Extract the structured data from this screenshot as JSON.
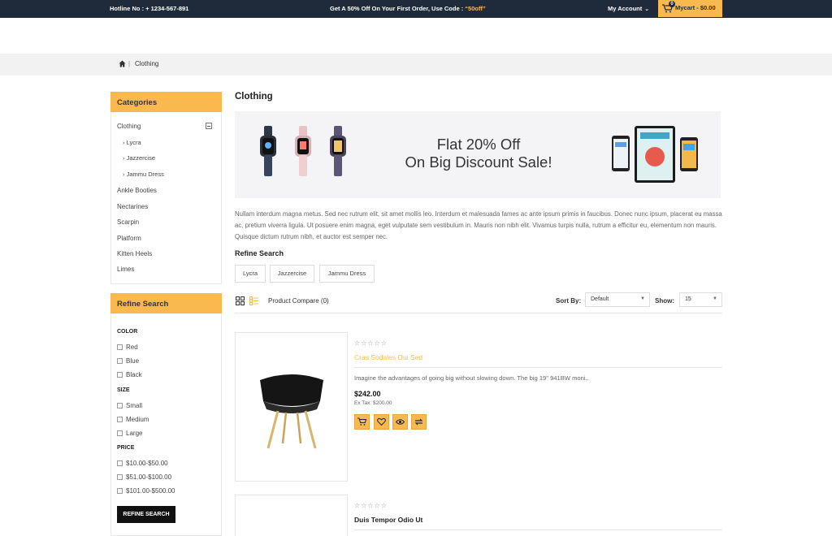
{
  "topbar": {
    "hotline": "Hotline No : + 1234-567-891",
    "promo_text": "Get A 50% Off On Your First Order, Use Code : ",
    "promo_code": "“50off”",
    "account_label": "My Account",
    "cart_count": "0",
    "cart_label": "Mycart - $0.00",
    "bg_color": "#1f2b3a",
    "accent_color": "#f9b94f"
  },
  "breadcrumb": {
    "home_icon": "home-icon",
    "separator": "|",
    "current": "Clothing"
  },
  "sidebar": {
    "categories_title": "Categories",
    "categories": [
      {
        "label": "Clothing",
        "subitems": [
          "› Lycra",
          "› Jazzercise",
          "› Jammu Dress"
        ]
      },
      {
        "label": "Ankle Booties"
      },
      {
        "label": "Nectarines"
      },
      {
        "label": "Scarpin"
      },
      {
        "label": "Platform"
      },
      {
        "label": "Kitten Heels"
      },
      {
        "label": "Limes"
      }
    ],
    "refine_title": "Refine Search",
    "filters": {
      "color": {
        "title": "COLOR",
        "options": [
          "Red",
          "Blue",
          "Black"
        ]
      },
      "size": {
        "title": "SIZE",
        "options": [
          "Small",
          "Medium",
          "Large"
        ]
      },
      "price": {
        "title": "PRICE",
        "options": [
          "$10.00-$50.00",
          "$51.00-$100.00",
          "$101.00-$500.00"
        ]
      }
    },
    "refine_button": "REFINE SEARCH"
  },
  "main": {
    "title": "Clothing",
    "banner": {
      "line1": "Flat 20% Off",
      "line2": "On Big Discount Sale!"
    },
    "description": "Nullam interdum magna metus. Sed nec rutrum elit, sit amet mollis leo. Interdum et malesuada fames ac ante ipsum primis in faucibus. Donec nunc ipsum, placerat eu massa ac, pretium viverra ligula. Ut posuere enim magna, eget vulputate sem vestibulum in. Mauris non nibh elit. Vivamus turpis nulla, rutrum a efficitur eu, elementum non mauris. Quisque dictum rutrum nibh, et auctor est semper nec.",
    "refine_title": "Refine Search",
    "chips": [
      "Lycra",
      "Jazzercise",
      "Jammu Dress"
    ],
    "toolbar": {
      "compare": "Product Compare (0)",
      "sort_label": "Sort By:",
      "sort_value": "Default",
      "show_label": "Show:",
      "show_value": "15"
    },
    "products": [
      {
        "stars": "☆☆☆☆☆",
        "name": "Cras Sodales Oui Sed",
        "description": "Imagine the advantages of going big without slowing down. The big 19\" 941BW moni..",
        "price": "$242.00",
        "ex_tax": "Ex Tax: $200.00",
        "name_color": "#f9b94f"
      },
      {
        "stars": "☆☆☆☆☆",
        "name": "Duis Tempor Odio Ut",
        "name_color": "#222222"
      }
    ]
  }
}
